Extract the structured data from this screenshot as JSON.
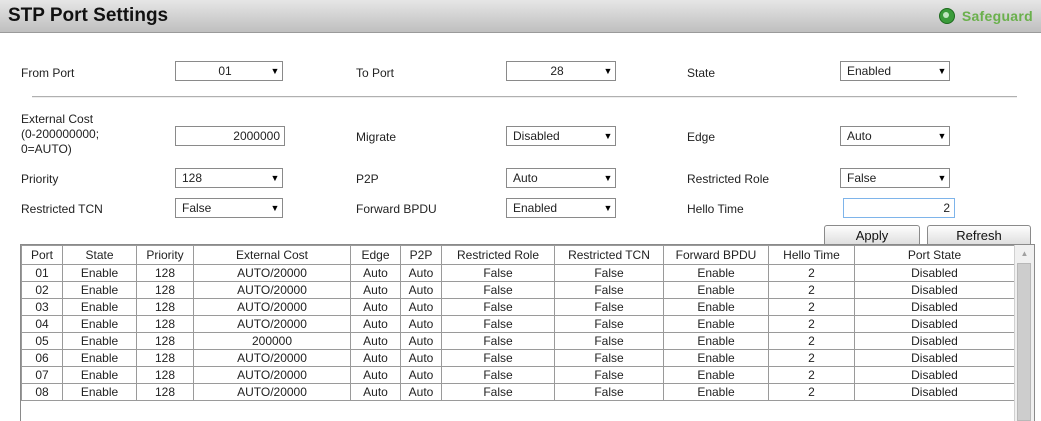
{
  "header": {
    "title": "STP Port Settings",
    "badge": "Safeguard",
    "badge_icon": "safeguard-status-icon",
    "badge_color": "#6ab04c"
  },
  "form": {
    "from_port": {
      "label": "From Port",
      "value": "01"
    },
    "to_port": {
      "label": "To Port",
      "value": "28"
    },
    "state": {
      "label": "State",
      "value": "Enabled"
    },
    "external_cost": {
      "label_line1": "External Cost",
      "label_line2": "(0-200000000;",
      "label_line3": "0=AUTO)",
      "value": "2000000"
    },
    "migrate": {
      "label": "Migrate",
      "value": "Disabled"
    },
    "edge": {
      "label": "Edge",
      "value": "Auto"
    },
    "priority": {
      "label": "Priority",
      "value": "128"
    },
    "p2p": {
      "label": "P2P",
      "value": "Auto"
    },
    "restricted_role": {
      "label": "Restricted Role",
      "value": "False"
    },
    "restricted_tcn": {
      "label": "Restricted TCN",
      "value": "False"
    },
    "forward_bpdu": {
      "label": "Forward BPDU",
      "value": "Enabled"
    },
    "hello_time": {
      "label": "Hello Time",
      "value": "2"
    }
  },
  "buttons": {
    "apply": "Apply",
    "refresh": "Refresh"
  },
  "table": {
    "columns": [
      "Port",
      "State",
      "Priority",
      "External Cost",
      "Edge",
      "P2P",
      "Restricted Role",
      "Restricted TCN",
      "Forward BPDU",
      "Hello Time",
      "Port State"
    ],
    "rows": [
      [
        "01",
        "Enable",
        "128",
        "AUTO/20000",
        "Auto",
        "Auto",
        "False",
        "False",
        "Enable",
        "2",
        "Disabled"
      ],
      [
        "02",
        "Enable",
        "128",
        "AUTO/20000",
        "Auto",
        "Auto",
        "False",
        "False",
        "Enable",
        "2",
        "Disabled"
      ],
      [
        "03",
        "Enable",
        "128",
        "AUTO/20000",
        "Auto",
        "Auto",
        "False",
        "False",
        "Enable",
        "2",
        "Disabled"
      ],
      [
        "04",
        "Enable",
        "128",
        "AUTO/20000",
        "Auto",
        "Auto",
        "False",
        "False",
        "Enable",
        "2",
        "Disabled"
      ],
      [
        "05",
        "Enable",
        "128",
        "200000",
        "Auto",
        "Auto",
        "False",
        "False",
        "Enable",
        "2",
        "Disabled"
      ],
      [
        "06",
        "Enable",
        "128",
        "AUTO/20000",
        "Auto",
        "Auto",
        "False",
        "False",
        "Enable",
        "2",
        "Disabled"
      ],
      [
        "07",
        "Enable",
        "128",
        "AUTO/20000",
        "Auto",
        "Auto",
        "False",
        "False",
        "Enable",
        "2",
        "Disabled"
      ],
      [
        "08",
        "Enable",
        "128",
        "AUTO/20000",
        "Auto",
        "Auto",
        "False",
        "False",
        "Enable",
        "2",
        "Disabled"
      ]
    ]
  }
}
